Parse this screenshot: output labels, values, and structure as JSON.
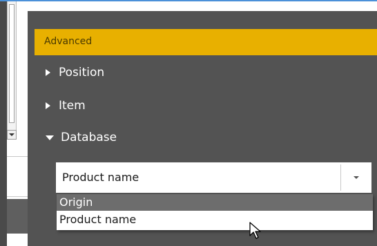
{
  "panel": {
    "header": "Advanced",
    "sections": [
      {
        "label": "Position",
        "expanded": false
      },
      {
        "label": "Item",
        "expanded": false
      },
      {
        "label": "Database",
        "expanded": true
      }
    ]
  },
  "field": {
    "value": "Product name",
    "options": [
      "Origin",
      "Product name"
    ]
  },
  "colors": {
    "panel_bg": "#535353",
    "header_bg": "#e8b000",
    "accent_line": "#4a90d9"
  }
}
